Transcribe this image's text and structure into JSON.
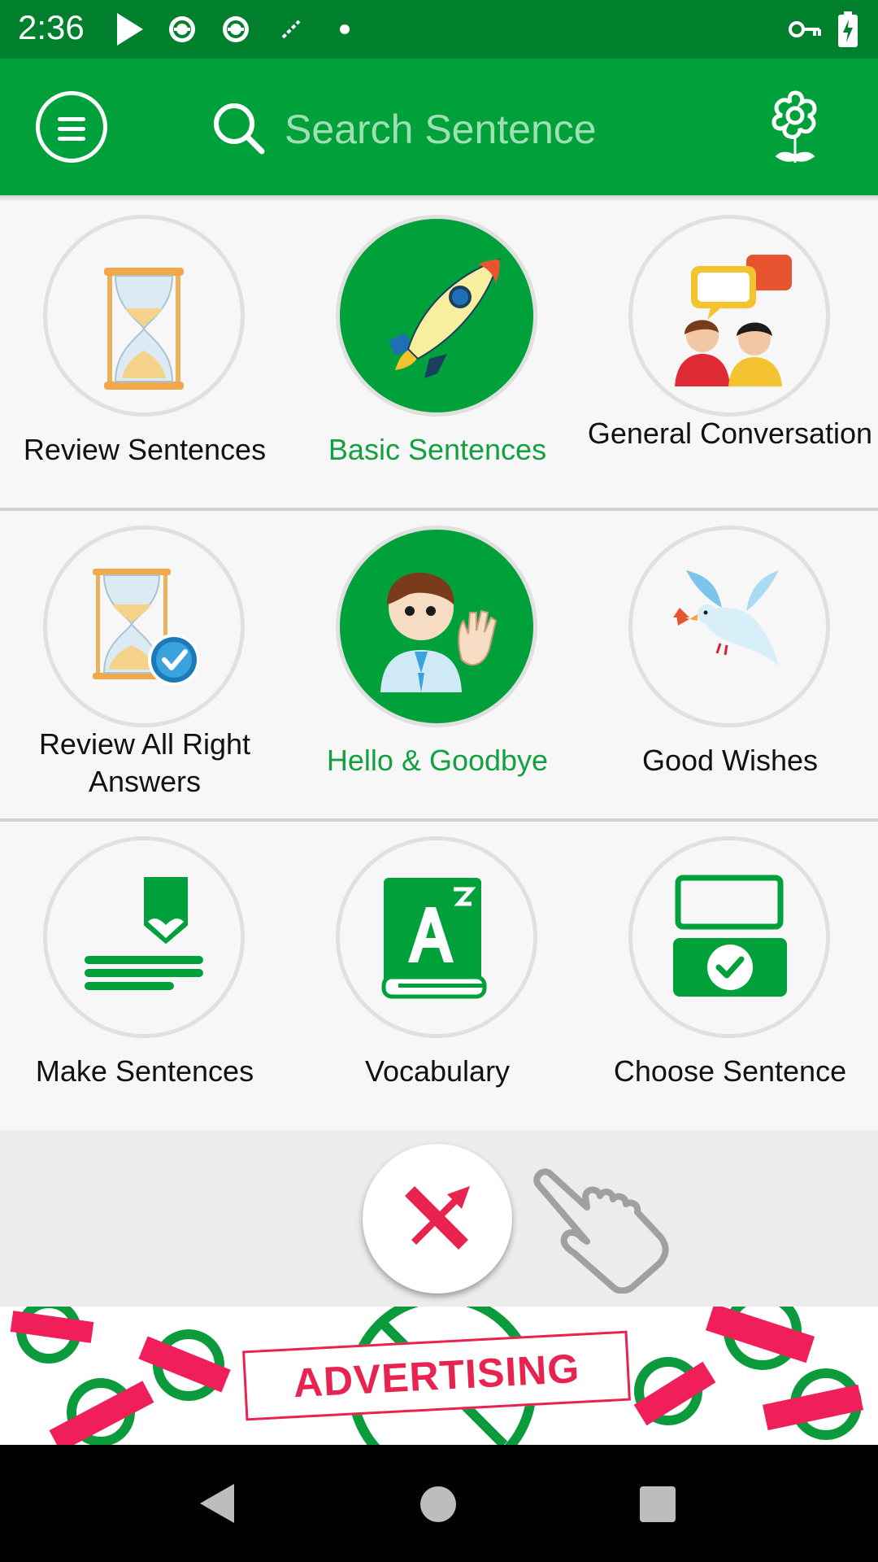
{
  "status_bar": {
    "time": "2:36",
    "icons": [
      "play-store-icon",
      "sync-icon",
      "sync-icon",
      "magic-icon",
      "dot-icon",
      "vpn-key-icon",
      "battery-charging-icon"
    ]
  },
  "app_bar": {
    "menu_icon": "menu-icon",
    "search": {
      "placeholder": "Search Sentence",
      "icon": "search-icon"
    },
    "settings_icon": "flower-gear-icon"
  },
  "grid": {
    "rows": [
      [
        {
          "label": "Review Sentences",
          "icon": "hourglass-icon",
          "active": false
        },
        {
          "label": "Basic Sentences",
          "icon": "rocket-icon",
          "active": true
        },
        {
          "label": "General Conversation",
          "icon": "conversation-icon",
          "active": false
        }
      ],
      [
        {
          "label": "Review All Right Answers",
          "icon": "hourglass-check-icon",
          "active": false
        },
        {
          "label": "Hello & Goodbye",
          "icon": "waving-person-icon",
          "active": true
        },
        {
          "label": "Good Wishes",
          "icon": "dove-icon",
          "active": false
        }
      ],
      [
        {
          "label": "Make Sentences",
          "icon": "pencil-lines-icon",
          "active": false
        },
        {
          "label": "Vocabulary",
          "icon": "dictionary-book-icon",
          "active": false
        },
        {
          "label": "Choose Sentence",
          "icon": "choose-check-icon",
          "active": false
        }
      ]
    ]
  },
  "action": {
    "fab_icon": "no-ads-icon",
    "hint_icon": "pointing-hand-icon"
  },
  "ad": {
    "text": "ADVERTISING"
  },
  "colors": {
    "primary": "#00a13a",
    "status": "#007f2c",
    "accent": "#e8234f",
    "active_label": "#12a040"
  },
  "nav_bar": {
    "icons": [
      "back-icon",
      "home-icon",
      "recents-icon"
    ]
  }
}
